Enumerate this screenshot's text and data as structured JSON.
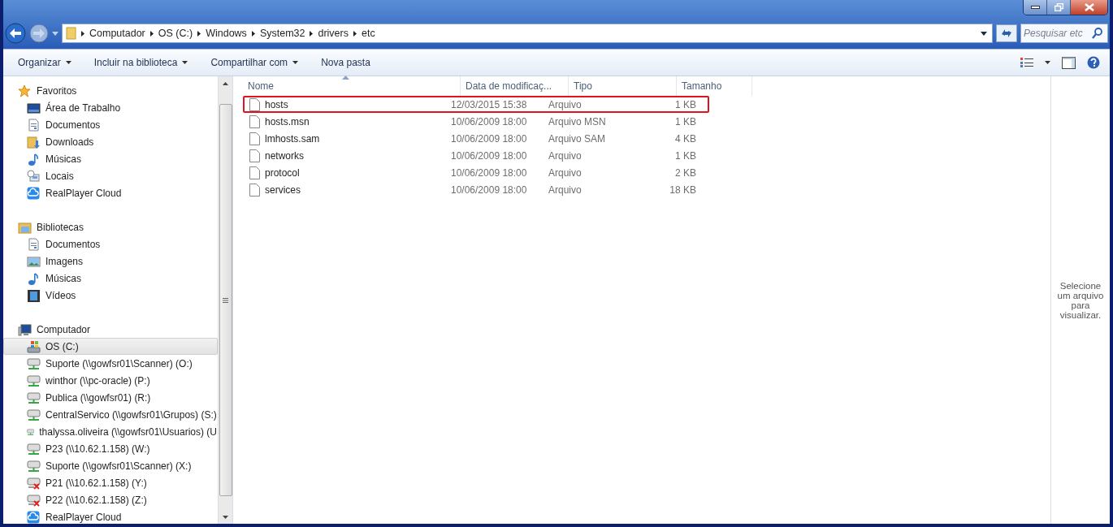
{
  "address_bar": {
    "crumbs": [
      "Computador",
      "OS (C:)",
      "Windows",
      "System32",
      "drivers",
      "etc"
    ]
  },
  "search": {
    "placeholder": "Pesquisar etc"
  },
  "toolbar": {
    "buttons": [
      {
        "label": "Organizar",
        "dropdown": true
      },
      {
        "label": "Incluir na biblioteca",
        "dropdown": true
      },
      {
        "label": "Compartilhar com",
        "dropdown": true
      },
      {
        "label": "Nova pasta",
        "dropdown": false
      }
    ]
  },
  "sidebar": {
    "groups": [
      {
        "label": "Favoritos",
        "kind": "star",
        "items": [
          {
            "label": "Área de Trabalho",
            "kind": "desktop",
            "selected": false
          },
          {
            "label": "Documentos",
            "kind": "document",
            "selected": false
          },
          {
            "label": "Downloads",
            "kind": "downloads",
            "selected": false
          },
          {
            "label": "Músicas",
            "kind": "music",
            "selected": false
          },
          {
            "label": "Locais",
            "kind": "places",
            "selected": false
          },
          {
            "label": "RealPlayer Cloud",
            "kind": "cloud",
            "selected": false
          }
        ]
      },
      {
        "label": "Bibliotecas",
        "kind": "library",
        "items": [
          {
            "label": "Documentos",
            "kind": "document",
            "selected": false
          },
          {
            "label": "Imagens",
            "kind": "images",
            "selected": false
          },
          {
            "label": "Músicas",
            "kind": "music",
            "selected": false
          },
          {
            "label": "Vídeos",
            "kind": "videos",
            "selected": false
          }
        ]
      },
      {
        "label": "Computador",
        "kind": "computer",
        "items": [
          {
            "label": "OS (C:)",
            "kind": "drive",
            "selected": true
          },
          {
            "label": "Suporte (\\\\gowfsr01\\Scanner) (O:)",
            "kind": "network",
            "selected": false
          },
          {
            "label": "winthor (\\\\pc-oracle) (P:)",
            "kind": "network",
            "selected": false
          },
          {
            "label": "Publica (\\\\gowfsr01) (R:)",
            "kind": "network",
            "selected": false
          },
          {
            "label": "CentralServico (\\\\gowfsr01\\Grupos) (S:)",
            "kind": "network",
            "selected": false
          },
          {
            "label": "thalyssa.oliveira (\\\\gowfsr01\\Usuarios) (U",
            "kind": "network",
            "selected": false
          },
          {
            "label": "P23 (\\\\10.62.1.158) (W:)",
            "kind": "network",
            "selected": false
          },
          {
            "label": "Suporte (\\\\gowfsr01\\Scanner) (X:)",
            "kind": "network",
            "selected": false
          },
          {
            "label": "P21 (\\\\10.62.1.158) (Y:)",
            "kind": "network-off",
            "selected": false
          },
          {
            "label": "P22 (\\\\10.62.1.158) (Z:)",
            "kind": "network-off",
            "selected": false
          },
          {
            "label": "RealPlayer Cloud",
            "kind": "cloud",
            "selected": false
          }
        ]
      }
    ]
  },
  "file_list": {
    "columns": [
      "Nome",
      "Data de modificaç...",
      "Tipo",
      "Tamanho"
    ],
    "rows": [
      {
        "name": "hosts",
        "modified": "12/03/2015 15:38",
        "type": "Arquivo",
        "size": "1 KB",
        "highlighted": true
      },
      {
        "name": "hosts.msn",
        "modified": "10/06/2009 18:00",
        "type": "Arquivo MSN",
        "size": "1 KB",
        "highlighted": false
      },
      {
        "name": "lmhosts.sam",
        "modified": "10/06/2009 18:00",
        "type": "Arquivo SAM",
        "size": "4 KB",
        "highlighted": false
      },
      {
        "name": "networks",
        "modified": "10/06/2009 18:00",
        "type": "Arquivo",
        "size": "1 KB",
        "highlighted": false
      },
      {
        "name": "protocol",
        "modified": "10/06/2009 18:00",
        "type": "Arquivo",
        "size": "2 KB",
        "highlighted": false
      },
      {
        "name": "services",
        "modified": "10/06/2009 18:00",
        "type": "Arquivo",
        "size": "18 KB",
        "highlighted": false
      }
    ]
  },
  "preview_pane": {
    "message": "Selecione um arquivo para visualizar."
  }
}
